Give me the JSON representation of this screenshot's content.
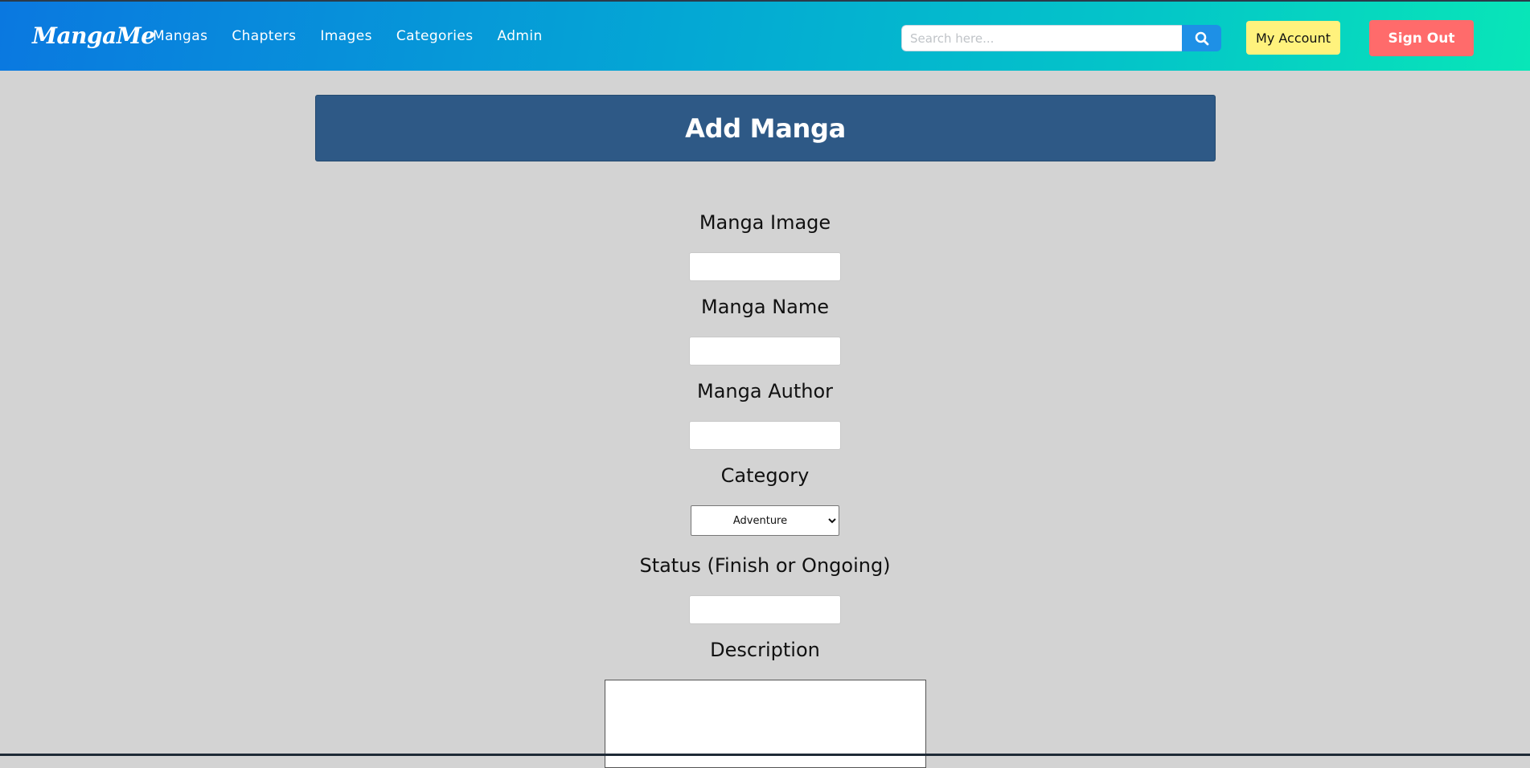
{
  "app": {
    "logo": "MangaMe"
  },
  "nav": {
    "items": [
      {
        "label": "Mangas"
      },
      {
        "label": "Chapters"
      },
      {
        "label": "Images"
      },
      {
        "label": "Categories"
      },
      {
        "label": "Admin"
      }
    ]
  },
  "search": {
    "placeholder": "Search here...",
    "icon": "search-icon"
  },
  "account": {
    "my_account_label": "My Account",
    "sign_out_label": "Sign Out"
  },
  "page": {
    "title": "Add Manga"
  },
  "form": {
    "image_label": "Manga Image",
    "image_value": "",
    "name_label": "Manga Name",
    "name_value": "",
    "author_label": "Manga Author",
    "author_value": "",
    "category_label": "Category",
    "category_selected": "Adventure",
    "status_label": "Status (Finish or Ongoing)",
    "status_value": "",
    "description_label": "Description",
    "description_value": ""
  },
  "colors": {
    "header_gradient_start": "#0a78e0",
    "header_gradient_end": "#08e6b8",
    "title_bar": "#2e5986",
    "my_account_bg": "#fff27d",
    "sign_out_bg": "#ff6b6b",
    "search_button": "#1e90e6",
    "page_bg": "#d3d3d3"
  }
}
